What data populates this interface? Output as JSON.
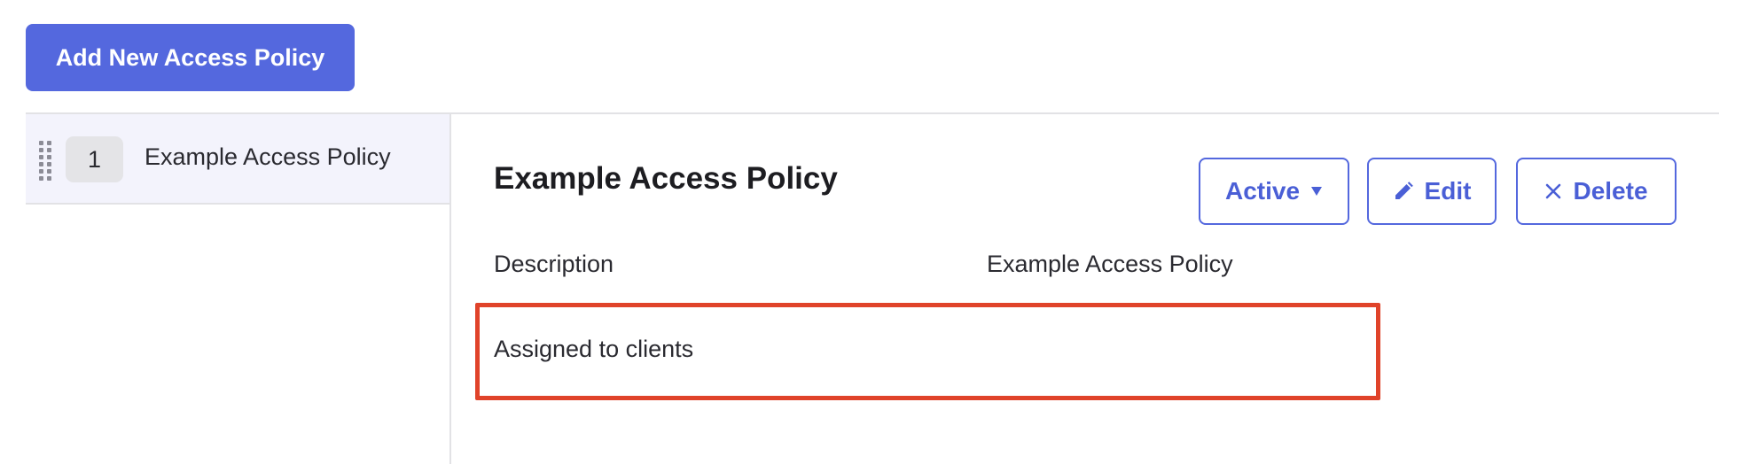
{
  "toolbar": {
    "add_label": "Add New Access Policy"
  },
  "sidebar": {
    "items": [
      {
        "order": "1",
        "label": "Example Access Policy",
        "selected": true
      }
    ]
  },
  "detail": {
    "title": "Example Access Policy",
    "status_label": "Active",
    "edit_label": "Edit",
    "delete_label": "Delete",
    "fields": [
      {
        "label": "Description",
        "value": "Example Access Policy"
      },
      {
        "label": "Assigned to clients",
        "value": ""
      }
    ]
  },
  "colors": {
    "accent": "#5468de",
    "highlight_border": "#e0432a",
    "selected_row_bg": "#f3f3fc",
    "badge_bg": "#e4e4e7",
    "divider": "#e2e2e5"
  },
  "icons": {
    "status_dropdown": "caret-down-icon",
    "edit": "pencil-icon",
    "delete": "close-icon",
    "drag": "drag-handle-icon"
  }
}
